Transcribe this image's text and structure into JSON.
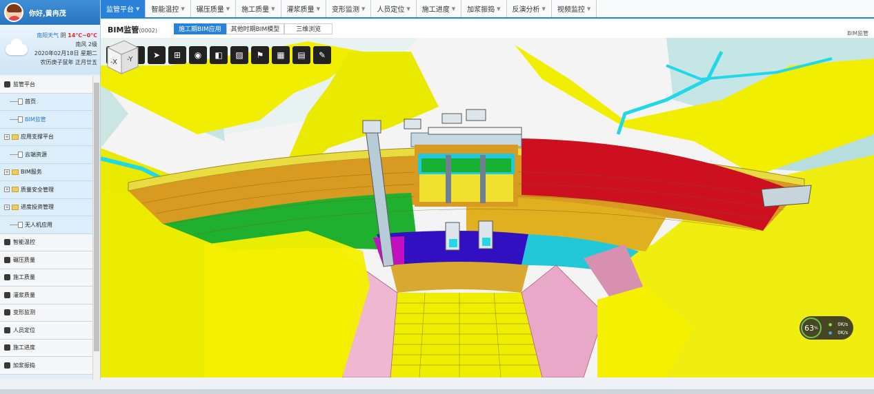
{
  "user": {
    "greeting": "你好,黄冉茂"
  },
  "weather": {
    "city": "南阳天气",
    "condition": "阴",
    "temp": "14℃~0℃",
    "wind": "南风 2级",
    "date": "2020年02月18日 星期二",
    "lunar": "农历庚子鼠年 正月廿五"
  },
  "menu": [
    {
      "label": "监管平台",
      "type": "main"
    },
    {
      "label": "首页",
      "type": "sub-doc"
    },
    {
      "label": "BIM监管",
      "type": "sub-doc",
      "active": true
    },
    {
      "label": "应用支撑平台",
      "type": "sub-folder"
    },
    {
      "label": "云端资源",
      "type": "sub-doc"
    },
    {
      "label": "BIM服务",
      "type": "sub-folder"
    },
    {
      "label": "质量安全管理",
      "type": "sub-folder"
    },
    {
      "label": "进度投资管理",
      "type": "sub-folder"
    },
    {
      "label": "无人机应用",
      "type": "sub-doc"
    },
    {
      "label": "智能温控",
      "type": "main"
    },
    {
      "label": "碾压质量",
      "type": "main"
    },
    {
      "label": "施工质量",
      "type": "main"
    },
    {
      "label": "灌浆质量",
      "type": "main"
    },
    {
      "label": "变形监测",
      "type": "main"
    },
    {
      "label": "人员定位",
      "type": "main"
    },
    {
      "label": "施工进度",
      "type": "main"
    },
    {
      "label": "加浆振捣",
      "type": "main"
    }
  ],
  "nav": {
    "tabs": [
      {
        "label": "监管平台",
        "active": true
      },
      {
        "label": "智能温控"
      },
      {
        "label": "碾压质量"
      },
      {
        "label": "施工质量"
      },
      {
        "label": "灌浆质量"
      },
      {
        "label": "变形监测"
      },
      {
        "label": "人员定位"
      },
      {
        "label": "施工进度"
      },
      {
        "label": "加浆振捣"
      },
      {
        "label": "反演分析"
      },
      {
        "label": "视频监控"
      }
    ],
    "arrow": "▼"
  },
  "page": {
    "title": "BIM监管",
    "code": "(0002)",
    "label_right": "BIM监管",
    "mode_tabs": [
      {
        "label": "施工期BIM应用",
        "active": true
      },
      {
        "label": "其他时期BIM模型"
      },
      {
        "label": "三维浏览"
      }
    ]
  },
  "toolbar": {
    "icons": [
      "info-icon",
      "location-pin-icon",
      "send-icon",
      "structure-icon",
      "camera-icon",
      "split-view-icon",
      "hatch-icon",
      "flag-icon",
      "grid-icon",
      "add-document-icon",
      "edit-icon"
    ]
  },
  "navcube": {
    "face_left": "-X",
    "face_right": "-Y"
  },
  "gauge": {
    "percent": "63",
    "unit": "%",
    "up": "0K/s",
    "down": "0K/s"
  },
  "colors": {
    "accent": "#2a82d8",
    "terrain": "#f2f000",
    "water": "#22d8e8",
    "dam_red": "#cc1020",
    "dam_orange": "#d89a20",
    "dam_green": "#20b030",
    "dam_purple": "#3010c0",
    "dam_pink": "#e8a8c8"
  }
}
